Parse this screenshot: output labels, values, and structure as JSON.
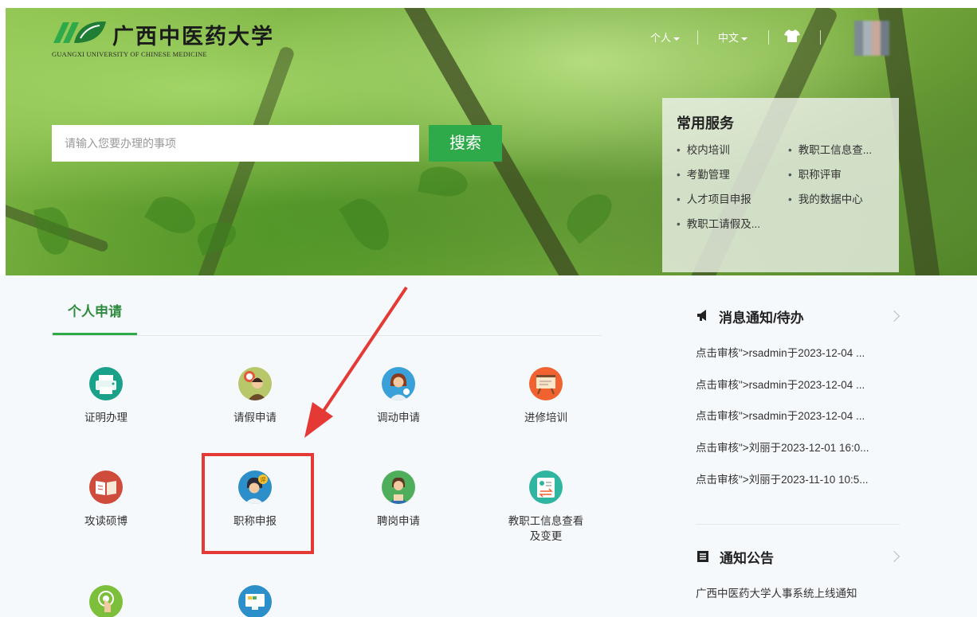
{
  "header": {
    "logo_cn": "广西中医药大学",
    "logo_en": "GUANGXI UNIVERSITY OF CHINESE MEDICINE",
    "nav_personal": "个人",
    "nav_language": "中文"
  },
  "search": {
    "placeholder": "请输入您要办理的事项",
    "button": "搜索"
  },
  "services": {
    "title": "常用服务",
    "items": [
      "校内培训",
      "教职工信息查...",
      "考勤管理",
      "职称评审",
      "人才项目申报",
      "我的数据中心",
      "教职工请假及..."
    ]
  },
  "apps": {
    "tab": "个人申请",
    "items": [
      {
        "label": "证明办理",
        "icon": "printer-icon"
      },
      {
        "label": "请假申请",
        "icon": "clock-person-icon"
      },
      {
        "label": "调动申请",
        "icon": "person-icon"
      },
      {
        "label": "进修培训",
        "icon": "board-icon"
      },
      {
        "label": "攻读硕博",
        "icon": "book-icon"
      },
      {
        "label": "职称申报",
        "icon": "title-badge-icon"
      },
      {
        "label": "聘岗申请",
        "icon": "employee-icon"
      },
      {
        "label": "教职工信息查看\n及变更",
        "icon": "profile-card-icon"
      },
      {
        "label": "",
        "icon": "touch-icon"
      },
      {
        "label": "",
        "icon": "monitor-icon"
      }
    ]
  },
  "messages": {
    "title": "消息通知/待办",
    "items": [
      "点击审核\">rsadmin于2023-12-04 ...",
      "点击审核\">rsadmin于2023-12-04 ...",
      "点击审核\">rsadmin于2023-12-04 ...",
      "点击审核\">刘丽于2023-12-01 16:0...",
      "点击审核\">刘丽于2023-11-10 10:5..."
    ]
  },
  "notices": {
    "title": "通知公告",
    "items": [
      "广西中医药大学人事系统上线通知"
    ]
  },
  "colors": {
    "accent": "#2eaa4a",
    "highlight": "#e53935"
  }
}
